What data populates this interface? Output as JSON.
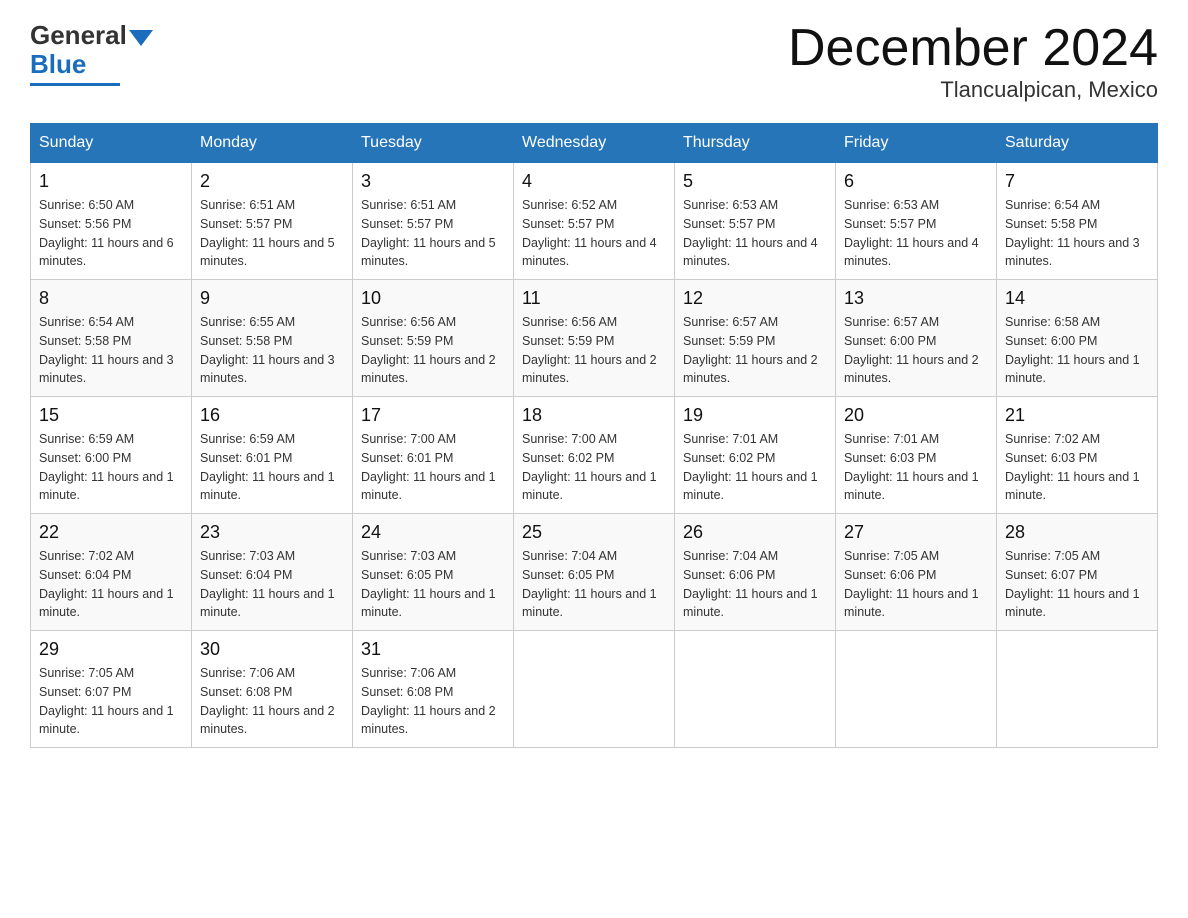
{
  "header": {
    "title": "December 2024",
    "subtitle": "Tlancualpican, Mexico",
    "logo_general": "General",
    "logo_blue": "Blue"
  },
  "weekdays": [
    "Sunday",
    "Monday",
    "Tuesday",
    "Wednesday",
    "Thursday",
    "Friday",
    "Saturday"
  ],
  "weeks": [
    [
      {
        "day": "1",
        "sunrise": "6:50 AM",
        "sunset": "5:56 PM",
        "daylight": "11 hours and 6 minutes."
      },
      {
        "day": "2",
        "sunrise": "6:51 AM",
        "sunset": "5:57 PM",
        "daylight": "11 hours and 5 minutes."
      },
      {
        "day": "3",
        "sunrise": "6:51 AM",
        "sunset": "5:57 PM",
        "daylight": "11 hours and 5 minutes."
      },
      {
        "day": "4",
        "sunrise": "6:52 AM",
        "sunset": "5:57 PM",
        "daylight": "11 hours and 4 minutes."
      },
      {
        "day": "5",
        "sunrise": "6:53 AM",
        "sunset": "5:57 PM",
        "daylight": "11 hours and 4 minutes."
      },
      {
        "day": "6",
        "sunrise": "6:53 AM",
        "sunset": "5:57 PM",
        "daylight": "11 hours and 4 minutes."
      },
      {
        "day": "7",
        "sunrise": "6:54 AM",
        "sunset": "5:58 PM",
        "daylight": "11 hours and 3 minutes."
      }
    ],
    [
      {
        "day": "8",
        "sunrise": "6:54 AM",
        "sunset": "5:58 PM",
        "daylight": "11 hours and 3 minutes."
      },
      {
        "day": "9",
        "sunrise": "6:55 AM",
        "sunset": "5:58 PM",
        "daylight": "11 hours and 3 minutes."
      },
      {
        "day": "10",
        "sunrise": "6:56 AM",
        "sunset": "5:59 PM",
        "daylight": "11 hours and 2 minutes."
      },
      {
        "day": "11",
        "sunrise": "6:56 AM",
        "sunset": "5:59 PM",
        "daylight": "11 hours and 2 minutes."
      },
      {
        "day": "12",
        "sunrise": "6:57 AM",
        "sunset": "5:59 PM",
        "daylight": "11 hours and 2 minutes."
      },
      {
        "day": "13",
        "sunrise": "6:57 AM",
        "sunset": "6:00 PM",
        "daylight": "11 hours and 2 minutes."
      },
      {
        "day": "14",
        "sunrise": "6:58 AM",
        "sunset": "6:00 PM",
        "daylight": "11 hours and 1 minute."
      }
    ],
    [
      {
        "day": "15",
        "sunrise": "6:59 AM",
        "sunset": "6:00 PM",
        "daylight": "11 hours and 1 minute."
      },
      {
        "day": "16",
        "sunrise": "6:59 AM",
        "sunset": "6:01 PM",
        "daylight": "11 hours and 1 minute."
      },
      {
        "day": "17",
        "sunrise": "7:00 AM",
        "sunset": "6:01 PM",
        "daylight": "11 hours and 1 minute."
      },
      {
        "day": "18",
        "sunrise": "7:00 AM",
        "sunset": "6:02 PM",
        "daylight": "11 hours and 1 minute."
      },
      {
        "day": "19",
        "sunrise": "7:01 AM",
        "sunset": "6:02 PM",
        "daylight": "11 hours and 1 minute."
      },
      {
        "day": "20",
        "sunrise": "7:01 AM",
        "sunset": "6:03 PM",
        "daylight": "11 hours and 1 minute."
      },
      {
        "day": "21",
        "sunrise": "7:02 AM",
        "sunset": "6:03 PM",
        "daylight": "11 hours and 1 minute."
      }
    ],
    [
      {
        "day": "22",
        "sunrise": "7:02 AM",
        "sunset": "6:04 PM",
        "daylight": "11 hours and 1 minute."
      },
      {
        "day": "23",
        "sunrise": "7:03 AM",
        "sunset": "6:04 PM",
        "daylight": "11 hours and 1 minute."
      },
      {
        "day": "24",
        "sunrise": "7:03 AM",
        "sunset": "6:05 PM",
        "daylight": "11 hours and 1 minute."
      },
      {
        "day": "25",
        "sunrise": "7:04 AM",
        "sunset": "6:05 PM",
        "daylight": "11 hours and 1 minute."
      },
      {
        "day": "26",
        "sunrise": "7:04 AM",
        "sunset": "6:06 PM",
        "daylight": "11 hours and 1 minute."
      },
      {
        "day": "27",
        "sunrise": "7:05 AM",
        "sunset": "6:06 PM",
        "daylight": "11 hours and 1 minute."
      },
      {
        "day": "28",
        "sunrise": "7:05 AM",
        "sunset": "6:07 PM",
        "daylight": "11 hours and 1 minute."
      }
    ],
    [
      {
        "day": "29",
        "sunrise": "7:05 AM",
        "sunset": "6:07 PM",
        "daylight": "11 hours and 1 minute."
      },
      {
        "day": "30",
        "sunrise": "7:06 AM",
        "sunset": "6:08 PM",
        "daylight": "11 hours and 2 minutes."
      },
      {
        "day": "31",
        "sunrise": "7:06 AM",
        "sunset": "6:08 PM",
        "daylight": "11 hours and 2 minutes."
      },
      null,
      null,
      null,
      null
    ]
  ],
  "labels": {
    "sunrise": "Sunrise:",
    "sunset": "Sunset:",
    "daylight": "Daylight:"
  }
}
